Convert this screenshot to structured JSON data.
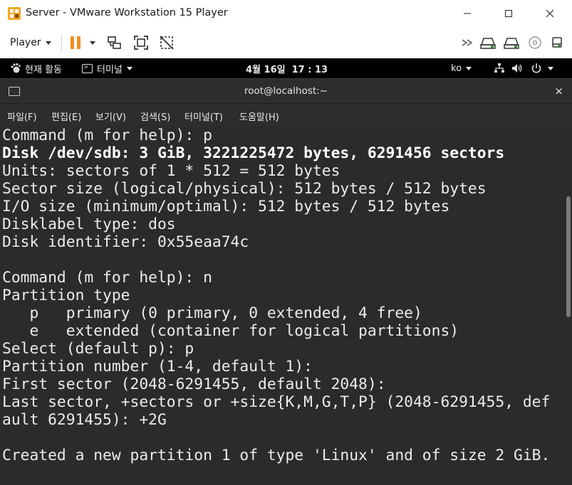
{
  "window": {
    "title": "Server - VMware Workstation 15 Player",
    "icon": "vmware-player-icon"
  },
  "toolbar": {
    "player_label": "Player",
    "icons": [
      "pause-icon",
      "send-ctrl-alt-del-icon",
      "fit-guest-icon",
      "unity-icon",
      "more-icon",
      "hard-disk-icon",
      "hard-disk-icon",
      "cd-dvd-icon",
      "usb-icon"
    ]
  },
  "gnome": {
    "activities": "현재 활동",
    "app_menu": "터미널",
    "clock": "4월 16일  17 : 13",
    "lang": "ko"
  },
  "terminal": {
    "title": "root@localhost:~",
    "close": "×",
    "menu": [
      "파일(F)",
      "편집(E)",
      "보기(V)",
      "검색(S)",
      "터미널(T)",
      "도움말(H)"
    ],
    "lines": [
      "Command (m for help): p",
      "Disk /dev/sdb: 3 GiB, 3221225472 bytes, 6291456 sectors",
      "Units: sectors of 1 * 512 = 512 bytes",
      "Sector size (logical/physical): 512 bytes / 512 bytes",
      "I/O size (minimum/optimal): 512 bytes / 512 bytes",
      "Disklabel type: dos",
      "Disk identifier: 0x55eaa74c",
      "",
      "Command (m for help): n",
      "Partition type",
      "   p   primary (0 primary, 0 extended, 4 free)",
      "   e   extended (container for logical partitions)",
      "Select (default p): p",
      "Partition number (1-4, default 1):",
      "First sector (2048-6291455, default 2048):",
      "Last sector, +sectors or +size{K,M,G,T,P} (2048-6291455, def",
      "ault 6291455): +2G",
      "",
      "Created a new partition 1 of type 'Linux' and of size 2 GiB."
    ]
  },
  "colors": {
    "accent_orange": "#f5a623",
    "toolbar_icon_green": "#2e8b2e",
    "terminal_bg": "#2b2b2b",
    "header_bg": "#2d2d2d",
    "top_bar_bg": "#000000"
  }
}
